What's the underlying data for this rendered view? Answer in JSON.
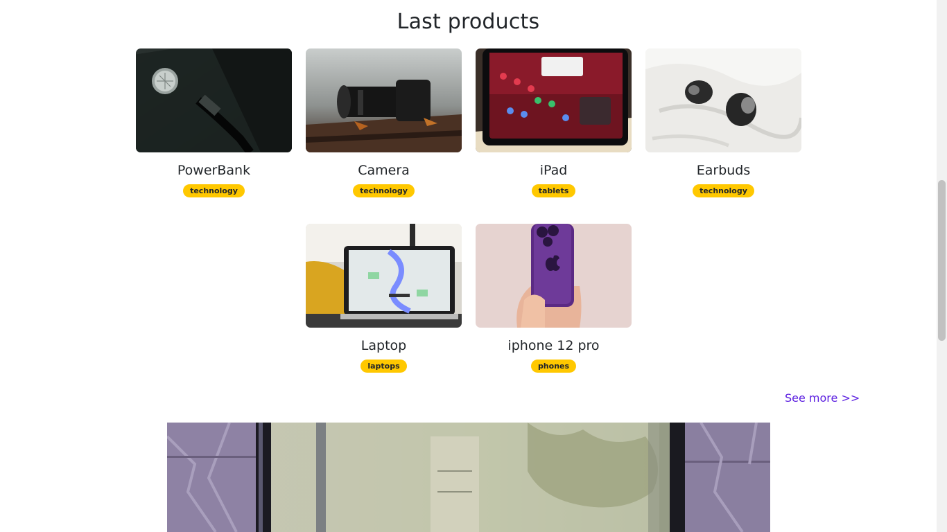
{
  "section": {
    "title": "Last products"
  },
  "products": [
    {
      "name": "PowerBank",
      "tag": "technology"
    },
    {
      "name": "Camera",
      "tag": "technology"
    },
    {
      "name": "iPad",
      "tag": "tablets"
    },
    {
      "name": "Earbuds",
      "tag": "technology"
    },
    {
      "name": "Laptop",
      "tag": "laptops"
    },
    {
      "name": "iphone 12 pro",
      "tag": "phones"
    }
  ],
  "links": {
    "see_more": "See more >>"
  },
  "colors": {
    "badge": "#ffc800",
    "link": "#5b1ee0"
  }
}
